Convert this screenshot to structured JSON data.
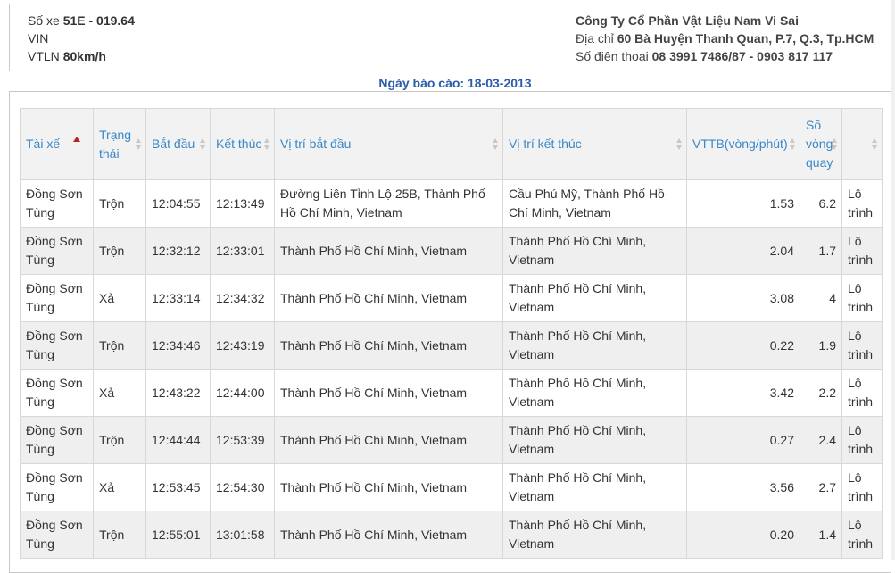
{
  "vehicle": {
    "plate_label": "Số xe",
    "plate_value": "51E - 019.64",
    "vin_label": "VIN",
    "speed_label": "VTLN",
    "speed_value": "80km/h"
  },
  "company": {
    "name": "Công Ty Cổ Phần Vật Liệu Nam Vi Sai",
    "address_label": "Địa chỉ",
    "address_value": "60 Bà Huyện Thanh Quan, P.7, Q.3, Tp.HCM",
    "phone_label": "Số điện thoại",
    "phone_value": "08 3991 7486/87 - 0903 817 117"
  },
  "report": {
    "date_label": "Ngày báo cáo:",
    "date_value": "18-03-2013"
  },
  "table": {
    "headers": {
      "driver": "Tài xế",
      "status": "Trạng thái",
      "start": "Bắt đầu",
      "end": "Kết thúc",
      "start_loc": "Vị trí bắt đầu",
      "end_loc": "Vị trí kết thúc",
      "avg_speed": "VTTB(vòng/phút)",
      "turns": "Số vòng quay",
      "route": ""
    },
    "rows": [
      {
        "driver": "Đồng Sơn Tùng",
        "status": "Trộn",
        "start": "12:04:55",
        "end": "12:13:49",
        "start_loc": "Đường Liên Tỉnh Lộ 25B, Thành Phố Hồ Chí Minh, Vietnam",
        "end_loc": "Cầu Phú Mỹ, Thành Phố Hồ Chí Minh, Vietnam",
        "avg_speed": "1.53",
        "turns": "6.2",
        "route": "Lộ trình"
      },
      {
        "driver": "Đồng Sơn Tùng",
        "status": "Trộn",
        "start": "12:32:12",
        "end": "12:33:01",
        "start_loc": "Thành Phố Hồ Chí Minh, Vietnam",
        "end_loc": "Thành Phố Hồ Chí Minh, Vietnam",
        "avg_speed": "2.04",
        "turns": "1.7",
        "route": "Lộ trình"
      },
      {
        "driver": "Đồng Sơn Tùng",
        "status": "Xả",
        "start": "12:33:14",
        "end": "12:34:32",
        "start_loc": "Thành Phố Hồ Chí Minh, Vietnam",
        "end_loc": "Thành Phố Hồ Chí Minh, Vietnam",
        "avg_speed": "3.08",
        "turns": "4",
        "route": "Lộ trình"
      },
      {
        "driver": "Đồng Sơn Tùng",
        "status": "Trộn",
        "start": "12:34:46",
        "end": "12:43:19",
        "start_loc": "Thành Phố Hồ Chí Minh, Vietnam",
        "end_loc": "Thành Phố Hồ Chí Minh, Vietnam",
        "avg_speed": "0.22",
        "turns": "1.9",
        "route": "Lộ trình"
      },
      {
        "driver": "Đồng Sơn Tùng",
        "status": "Xả",
        "start": "12:43:22",
        "end": "12:44:00",
        "start_loc": "Thành Phố Hồ Chí Minh, Vietnam",
        "end_loc": "Thành Phố Hồ Chí Minh, Vietnam",
        "avg_speed": "3.42",
        "turns": "2.2",
        "route": "Lộ trình"
      },
      {
        "driver": "Đồng Sơn Tùng",
        "status": "Trộn",
        "start": "12:44:44",
        "end": "12:53:39",
        "start_loc": "Thành Phố Hồ Chí Minh, Vietnam",
        "end_loc": "Thành Phố Hồ Chí Minh, Vietnam",
        "avg_speed": "0.27",
        "turns": "2.4",
        "route": "Lộ trình"
      },
      {
        "driver": "Đồng Sơn Tùng",
        "status": "Xả",
        "start": "12:53:45",
        "end": "12:54:30",
        "start_loc": "Thành Phố Hồ Chí Minh, Vietnam",
        "end_loc": "Thành Phố Hồ Chí Minh, Vietnam",
        "avg_speed": "3.56",
        "turns": "2.7",
        "route": "Lộ trình"
      },
      {
        "driver": "Đồng Sơn Tùng",
        "status": "Trộn",
        "start": "12:55:01",
        "end": "13:01:58",
        "start_loc": "Thành Phố Hồ Chí Minh, Vietnam",
        "end_loc": "Thành Phố Hồ Chí Minh, Vietnam",
        "avg_speed": "0.20",
        "turns": "1.4",
        "route": "Lộ trình"
      }
    ]
  },
  "colors": {
    "header_text": "#3a87c8",
    "link": "#3b6cc0",
    "report_date": "#2a5caa",
    "sort_active": "#bb2222"
  }
}
